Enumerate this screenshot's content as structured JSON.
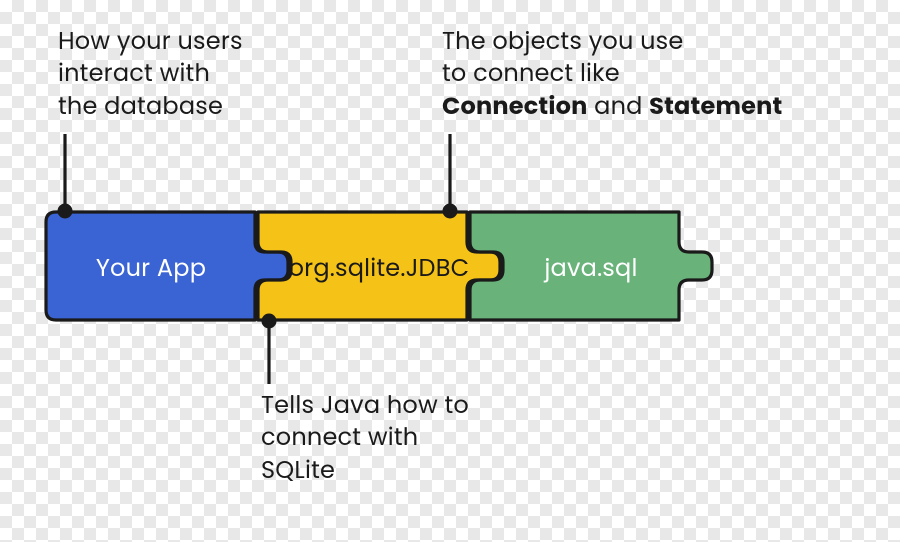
{
  "colors": {
    "blue": "#3A63D4",
    "yellow": "#F5C317",
    "green": "#69B37A",
    "outline": "#1a1a1a"
  },
  "pieces": {
    "left": {
      "label": "Your App"
    },
    "mid": {
      "label": "org.sqlite.JDBC"
    },
    "right": {
      "label": "java.sql"
    }
  },
  "annotations": {
    "topLeft": {
      "line1": "How your users",
      "line2": "interact with",
      "line3": "the database"
    },
    "topRight": {
      "line1": "The objects you use",
      "line2": "to connect like",
      "bold1": "Connection",
      "mid": " and ",
      "bold2": "Statement"
    },
    "bottom": {
      "line1": "Tells Java how to",
      "line2": "connect with",
      "line3": "SQLite"
    }
  }
}
